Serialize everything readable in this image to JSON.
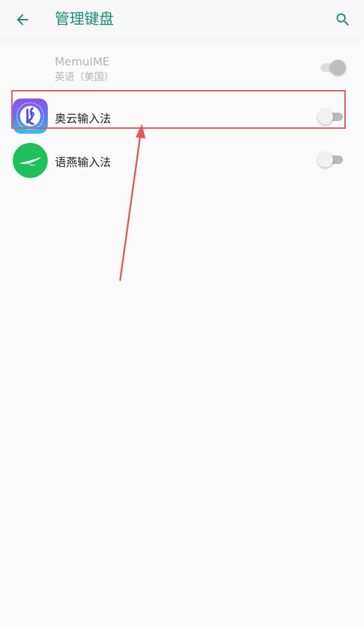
{
  "header": {
    "title": "管理键盘",
    "back_icon": "arrow-left-icon",
    "search_icon": "search-icon"
  },
  "keyboards": [
    {
      "name": "MemuIME",
      "subtitle": "英语（美国）",
      "enabled": true,
      "disabled_state": true
    },
    {
      "name": "奥云输入法",
      "icon": "aoyun-app-icon",
      "enabled": false
    },
    {
      "name": "语燕输入法",
      "icon": "yuyan-app-icon",
      "enabled": false
    }
  ],
  "colors": {
    "accent": "#1a8a79",
    "annotation": "#e05a5a",
    "background": "#fafafa"
  }
}
